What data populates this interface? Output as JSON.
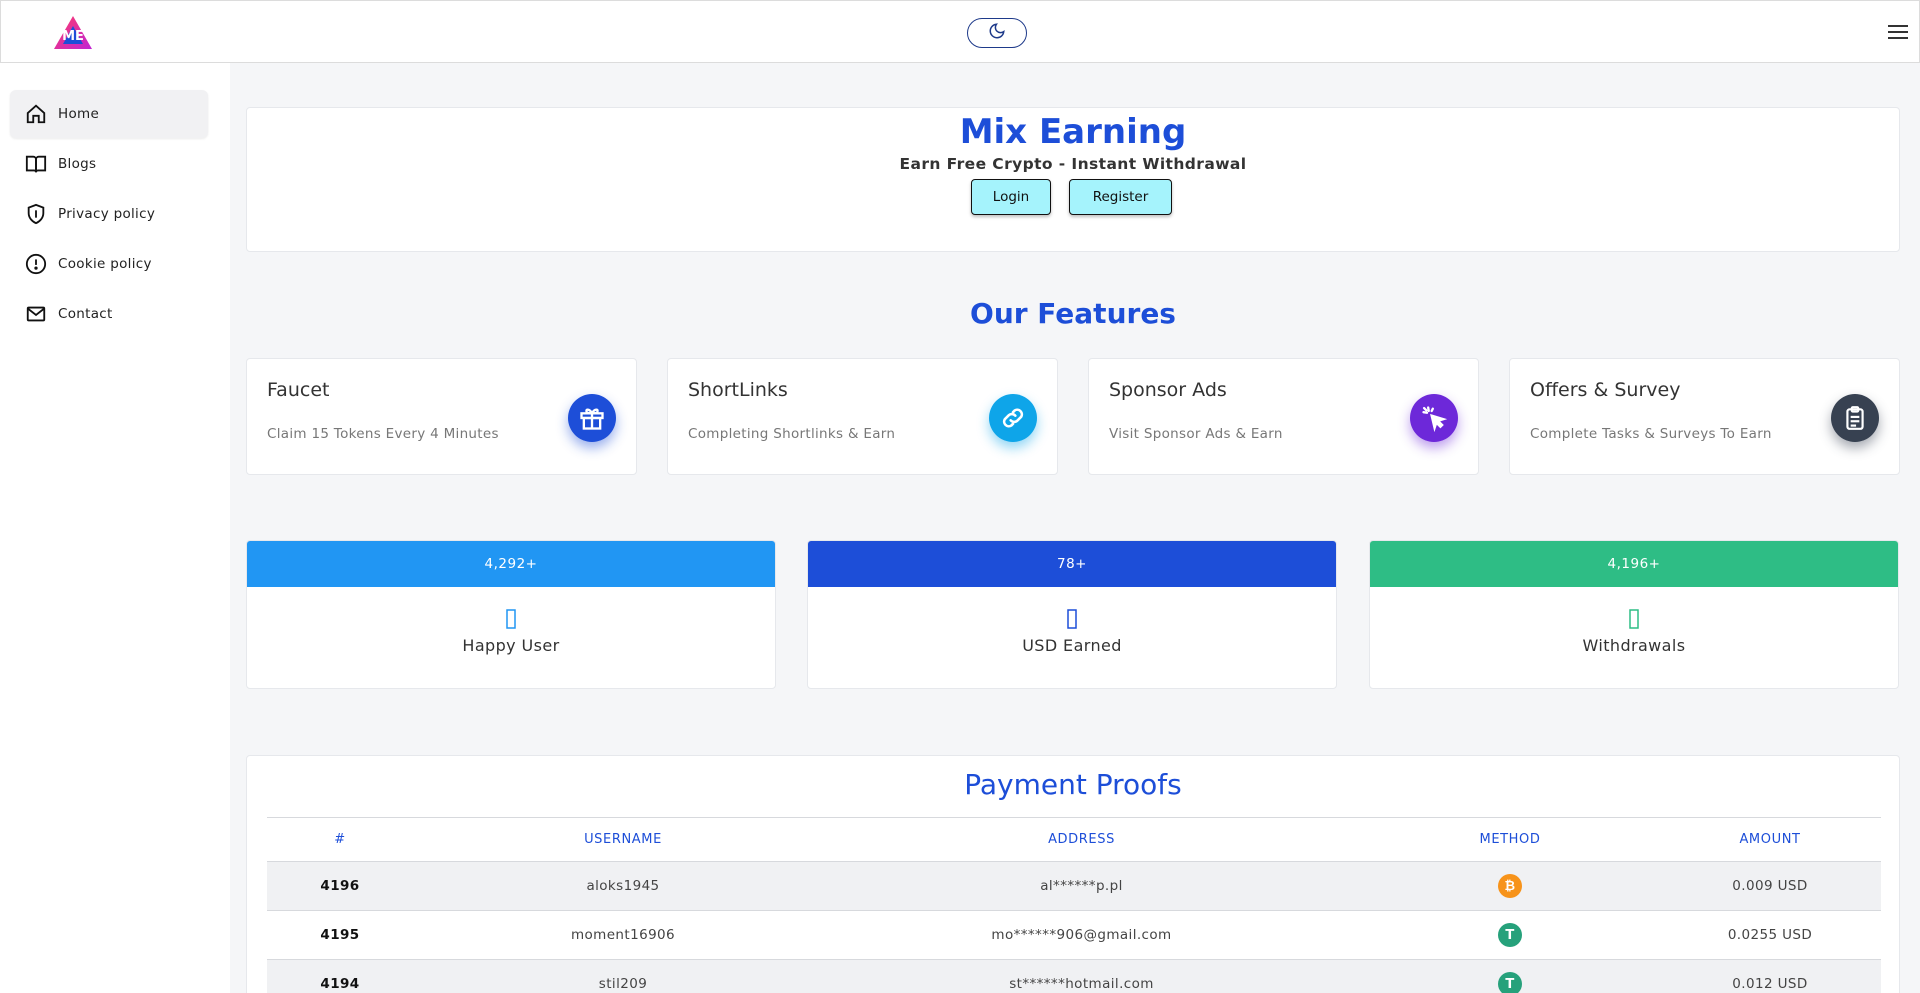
{
  "header": {
    "logo_text": "ME",
    "theme_toggle_icon": "moon-icon",
    "menu_icon": "hamburger-icon"
  },
  "sidebar": {
    "items": [
      {
        "label": "Home",
        "icon": "home-icon",
        "active": true
      },
      {
        "label": "Blogs",
        "icon": "book-icon",
        "active": false
      },
      {
        "label": "Privacy policy",
        "icon": "shield-icon",
        "active": false
      },
      {
        "label": "Cookie policy",
        "icon": "alert-circle-icon",
        "active": false
      },
      {
        "label": "Contact",
        "icon": "mail-icon",
        "active": false
      }
    ]
  },
  "hero": {
    "title": "Mix Earning",
    "subtitle": "Earn Free Crypto - Instant Withdrawal",
    "login_label": "Login",
    "register_label": "Register"
  },
  "features": {
    "title": "Our Features",
    "items": [
      {
        "title": "Faucet",
        "desc": "Claim 15 Tokens Every 4 Minutes",
        "icon": "gift-icon",
        "color": "#1d4ed8"
      },
      {
        "title": "ShortLinks",
        "desc": "Completing Shortlinks & Earn",
        "icon": "link-icon",
        "color": "#0ea5e9"
      },
      {
        "title": "Sponsor Ads",
        "desc": "Visit Sponsor Ads & Earn",
        "icon": "cursor-click-icon",
        "color": "#6d28d9"
      },
      {
        "title": "Offers & Survey",
        "desc": "Complete Tasks & Surveys To Earn",
        "icon": "clipboard-icon",
        "color": "#374151"
      }
    ]
  },
  "stats": [
    {
      "value": "4,292+",
      "label": "Happy User",
      "color": "#2196f3"
    },
    {
      "value": "78+",
      "label": "USD Earned",
      "color": "#1d4ed8"
    },
    {
      "value": "4,196+",
      "label": "Withdrawals",
      "color": "#2ebd85"
    }
  ],
  "payment_proofs": {
    "title": "Payment Proofs",
    "columns": [
      "#",
      "USERNAME",
      "ADDRESS",
      "METHOD",
      "AMOUNT"
    ],
    "rows": [
      {
        "id": "4196",
        "username": "aloks1945",
        "address": "al******p.pl",
        "method": "bitcoin",
        "amount": "0.009 USD"
      },
      {
        "id": "4195",
        "username": "moment16906",
        "address": "mo******906@gmail.com",
        "method": "tether",
        "amount": "0.0255 USD"
      },
      {
        "id": "4194",
        "username": "stil209",
        "address": "st******hotmail.com",
        "method": "tether",
        "amount": "0.012 USD"
      }
    ]
  }
}
